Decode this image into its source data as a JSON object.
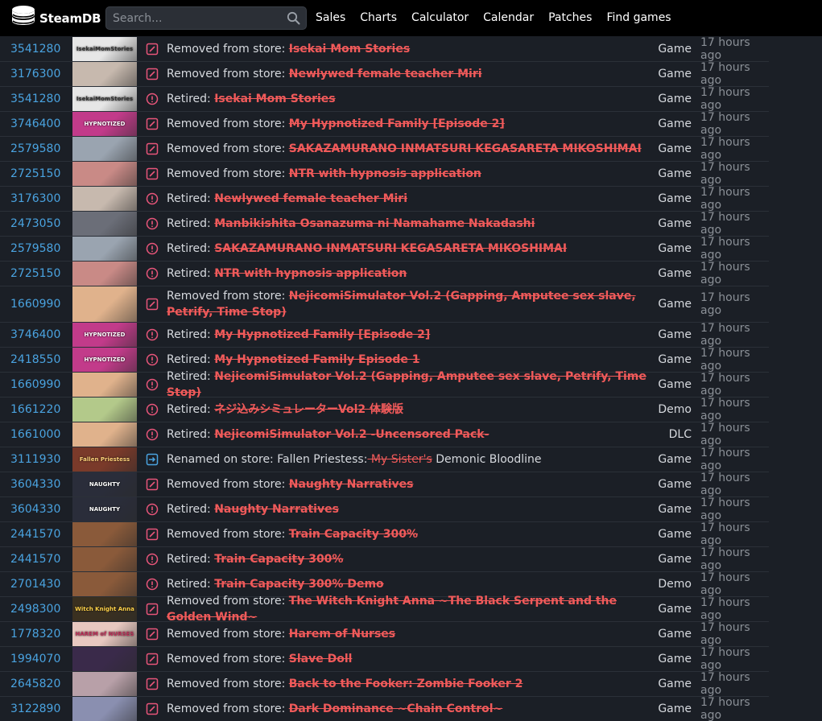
{
  "header": {
    "logo_text": "SteamDB",
    "search_placeholder": "Search...",
    "nav": [
      "Sales",
      "Charts",
      "Calculator",
      "Calendar",
      "Patches",
      "Find games"
    ]
  },
  "colors": {
    "link": "#4aa3e0",
    "removed": "#f05a5a",
    "edit_icon": "#e8557a",
    "retired_icon": "#e8557a",
    "renamed_icon": "#4aa3e0"
  },
  "rows": [
    {
      "id": "3541280",
      "kind": "removed",
      "prefix": "Removed from store: ",
      "name": "Isekai Mom Stories",
      "type": "Game",
      "time": "17 hours ago",
      "capsule": {
        "text": "IsekaiMomStories",
        "bg": "#e6e6e6",
        "fg": "#333333"
      }
    },
    {
      "id": "3176300",
      "kind": "removed",
      "prefix": "Removed from store: ",
      "name": "Newlywed female teacher Miri",
      "type": "Game",
      "time": "17 hours ago",
      "capsule": {
        "text": "",
        "bg": "#c7b9ae",
        "fg": "#ffffff"
      }
    },
    {
      "id": "3541280",
      "kind": "retired",
      "prefix": "Retired: ",
      "name": "Isekai Mom Stories",
      "type": "Game",
      "time": "17 hours ago",
      "capsule": {
        "text": "IsekaiMomStories",
        "bg": "#e6e6e6",
        "fg": "#333333"
      }
    },
    {
      "id": "3746400",
      "kind": "removed",
      "prefix": "Removed from store: ",
      "name": "My Hypnotized Family [Episode 2]",
      "type": "Game",
      "time": "17 hours ago",
      "capsule": {
        "text": "HYPNOTIZED",
        "bg": "#c23b8a",
        "fg": "#ffffff"
      }
    },
    {
      "id": "2579580",
      "kind": "removed",
      "prefix": "Removed from store: ",
      "name": "SAKAZAMURANO INMATSURI KEGASARETA MIKOSHIMAI",
      "type": "Game",
      "time": "17 hours ago",
      "capsule": {
        "text": "",
        "bg": "#9aa4b0",
        "fg": "#ffffff"
      }
    },
    {
      "id": "2725150",
      "kind": "removed",
      "prefix": "Removed from store: ",
      "name": "NTR with hypnosis application",
      "type": "Game",
      "time": "17 hours ago",
      "capsule": {
        "text": "",
        "bg": "#c98a86",
        "fg": "#ffffff"
      }
    },
    {
      "id": "3176300",
      "kind": "retired",
      "prefix": "Retired: ",
      "name": "Newlywed female teacher Miri",
      "type": "Game",
      "time": "17 hours ago",
      "capsule": {
        "text": "",
        "bg": "#c7b9ae",
        "fg": "#ffffff"
      }
    },
    {
      "id": "2473050",
      "kind": "retired",
      "prefix": "Retired: ",
      "name": "Manbikishita Osanazuma ni Namahame Nakadashi",
      "type": "Game",
      "time": "17 hours ago",
      "capsule": {
        "text": "",
        "bg": "#6b6e78",
        "fg": "#ffffff"
      }
    },
    {
      "id": "2579580",
      "kind": "retired",
      "prefix": "Retired: ",
      "name": "SAKAZAMURANO INMATSURI KEGASARETA MIKOSHIMAI",
      "type": "Game",
      "time": "17 hours ago",
      "capsule": {
        "text": "",
        "bg": "#9aa4b0",
        "fg": "#ffffff"
      }
    },
    {
      "id": "2725150",
      "kind": "retired",
      "prefix": "Retired: ",
      "name": "NTR with hypnosis application",
      "type": "Game",
      "time": "17 hours ago",
      "capsule": {
        "text": "",
        "bg": "#c98a86",
        "fg": "#ffffff"
      }
    },
    {
      "id": "1660990",
      "kind": "removed",
      "prefix": "Removed from store: ",
      "name": "NejicomiSimulator Vol.2 (Gapping, Amputee sex slave, Petrify, Time Stop)",
      "type": "Game",
      "time": "17 hours ago",
      "tall": true,
      "capsule": {
        "text": "",
        "bg": "#e0b28c",
        "fg": "#ffffff"
      }
    },
    {
      "id": "3746400",
      "kind": "retired",
      "prefix": "Retired: ",
      "name": "My Hypnotized Family [Episode 2]",
      "type": "Game",
      "time": "17 hours ago",
      "capsule": {
        "text": "HYPNOTIZED",
        "bg": "#c23b8a",
        "fg": "#ffffff"
      }
    },
    {
      "id": "2418550",
      "kind": "retired",
      "prefix": "Retired: ",
      "name": "My Hypnotized Family Episode 1",
      "type": "Game",
      "time": "17 hours ago",
      "capsule": {
        "text": "HYPNOTIZED",
        "bg": "#c23b8a",
        "fg": "#ffffff"
      }
    },
    {
      "id": "1660990",
      "kind": "retired",
      "prefix": "Retired: ",
      "name": "NejicomiSimulator Vol.2 (Gapping, Amputee sex slave, Petrify, Time Stop)",
      "type": "Game",
      "time": "17 hours ago",
      "capsule": {
        "text": "",
        "bg": "#e0b28c",
        "fg": "#ffffff"
      }
    },
    {
      "id": "1661220",
      "kind": "retired",
      "prefix": "Retired: ",
      "name": "ネジ込みシミュレーターVol2 体験版",
      "type": "Demo",
      "time": "17 hours ago",
      "capsule": {
        "text": "",
        "bg": "#b3c98a",
        "fg": "#ffffff"
      }
    },
    {
      "id": "1661000",
      "kind": "retired",
      "prefix": "Retired: ",
      "name": "NejicomiSimulator Vol.2 -Uncensored Pack-",
      "type": "DLC",
      "time": "17 hours ago",
      "capsule": {
        "text": "",
        "bg": "#e0b28c",
        "fg": "#ffffff"
      }
    },
    {
      "id": "3111930",
      "kind": "renamed",
      "prefix": "Renamed on store: Fallen Priestess:",
      "name": " My Sister's",
      "suffix": " Demonic Bloodline",
      "type": "Game",
      "time": "17 hours ago",
      "capsule": {
        "text": "Fallen Priestess",
        "bg": "#7a3a2a",
        "fg": "#ffd27a"
      }
    },
    {
      "id": "3604330",
      "kind": "removed",
      "prefix": "Removed from store: ",
      "name": "Naughty Narratives",
      "type": "Game",
      "time": "17 hours ago",
      "capsule": {
        "text": "NAUGHTY",
        "bg": "#2a2d3a",
        "fg": "#ffffff"
      }
    },
    {
      "id": "3604330",
      "kind": "retired",
      "prefix": "Retired: ",
      "name": "Naughty Narratives",
      "type": "Game",
      "time": "17 hours ago",
      "capsule": {
        "text": "NAUGHTY",
        "bg": "#2a2d3a",
        "fg": "#ffffff"
      }
    },
    {
      "id": "2441570",
      "kind": "removed",
      "prefix": "Removed from store: ",
      "name": "Train Capacity 300%",
      "type": "Game",
      "time": "17 hours ago",
      "capsule": {
        "text": "",
        "bg": "#8a5a3a",
        "fg": "#ffffff"
      }
    },
    {
      "id": "2441570",
      "kind": "retired",
      "prefix": "Retired: ",
      "name": "Train Capacity 300%",
      "type": "Game",
      "time": "17 hours ago",
      "capsule": {
        "text": "",
        "bg": "#8a5a3a",
        "fg": "#ffffff"
      }
    },
    {
      "id": "2701430",
      "kind": "retired",
      "prefix": "Retired: ",
      "name": "Train Capacity 300% Demo",
      "type": "Demo",
      "time": "17 hours ago",
      "capsule": {
        "text": "",
        "bg": "#8a5a3a",
        "fg": "#ffffff"
      }
    },
    {
      "id": "2498300",
      "kind": "removed",
      "prefix": "Removed from store: ",
      "name": "The Witch Knight Anna ~The Black Serpent and the Golden Wind~",
      "type": "Game",
      "time": "17 hours ago",
      "capsule": {
        "text": "Witch Knight Anna",
        "bg": "#3a3020",
        "fg": "#ffd24a"
      }
    },
    {
      "id": "1778320",
      "kind": "removed",
      "prefix": "Removed from store: ",
      "name": "Harem of Nurses",
      "type": "Game",
      "time": "17 hours ago",
      "capsule": {
        "text": "HAREM of NURSES",
        "bg": "#e8c8c0",
        "fg": "#c0305a"
      }
    },
    {
      "id": "1994070",
      "kind": "removed",
      "prefix": "Removed from store: ",
      "name": "Slave Doll",
      "type": "Game",
      "time": "17 hours ago",
      "capsule": {
        "text": "",
        "bg": "#3a2a4a",
        "fg": "#ffffff"
      }
    },
    {
      "id": "2645820",
      "kind": "removed",
      "prefix": "Removed from store: ",
      "name": "Back to the Fooker: Zombie Fooker 2",
      "type": "Game",
      "time": "17 hours ago",
      "capsule": {
        "text": "",
        "bg": "#b8a0a8",
        "fg": "#ffffff"
      }
    },
    {
      "id": "3122890",
      "kind": "removed",
      "prefix": "Removed from store: ",
      "name": "Dark Dominance ~Chain Control~",
      "type": "Game",
      "time": "17 hours ago",
      "capsule": {
        "text": "",
        "bg": "#8a8fb0",
        "fg": "#ffffff"
      }
    }
  ]
}
